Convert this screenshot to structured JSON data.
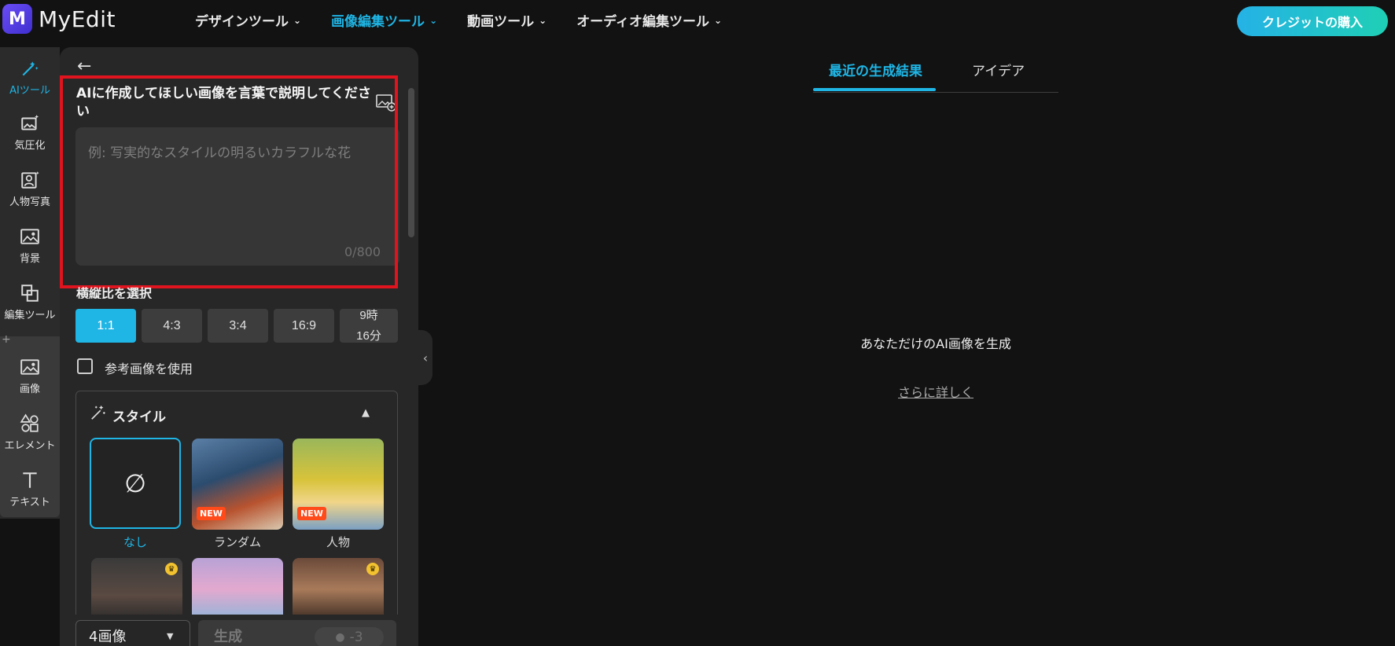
{
  "app": {
    "logo_mark": "M",
    "name": "MyEdit"
  },
  "nav": [
    {
      "label": "デザインツール",
      "active": false
    },
    {
      "label": "画像編集ツール",
      "active": true
    },
    {
      "label": "動画ツール",
      "active": false
    },
    {
      "label": "オーディオ編集ツール",
      "active": false
    }
  ],
  "header": {
    "buy_label": "クレジットの購入"
  },
  "rail": [
    {
      "label": "AIツール",
      "icon": "magic-wand-icon",
      "active": true
    },
    {
      "label": "気圧化",
      "icon": "image-sparkle-icon"
    },
    {
      "label": "人物写真",
      "icon": "person-photo-icon"
    },
    {
      "label": "背景",
      "icon": "background-icon"
    },
    {
      "label": "編集ツール",
      "icon": "edit-tools-icon"
    },
    {
      "label": "画像",
      "icon": "image-icon"
    },
    {
      "label": "エレメント",
      "icon": "elements-icon"
    },
    {
      "label": "テキスト",
      "icon": "text-icon"
    }
  ],
  "panel": {
    "prompt_label": "AIに作成してほしい画像を言葉で説明してください",
    "prompt_placeholder": "例: 写実的なスタイルの明るいカラフルな花",
    "char_count": "0/800",
    "ratio_label": "横縦比を選択",
    "ratios": [
      "1:1",
      "4:3",
      "3:4",
      "16:9"
    ],
    "ratio_last_line1": "9時",
    "ratio_last_line2": "16分",
    "selected_ratio": "1:1",
    "reference_label": "参考画像を使用",
    "style_title": "スタイル",
    "styles": [
      {
        "label": "なし",
        "selected": true
      },
      {
        "label": "ランダム",
        "badge": "NEW"
      },
      {
        "label": "人物",
        "badge": "NEW"
      }
    ],
    "count_value": "4画像",
    "generate_label": "生成",
    "cost": "-3"
  },
  "main": {
    "tabs": [
      {
        "label": "最近の生成結果",
        "active": true
      },
      {
        "label": "アイデア",
        "active": false
      }
    ],
    "empty_title": "あなただけのAI画像を生成",
    "learn_more": "さらに詳しく"
  },
  "colors": {
    "accent": "#1fb5e5",
    "highlight_border": "#e0141e",
    "buy_gradient_start": "#25b2e6",
    "buy_gradient_end": "#1fcfb5"
  }
}
